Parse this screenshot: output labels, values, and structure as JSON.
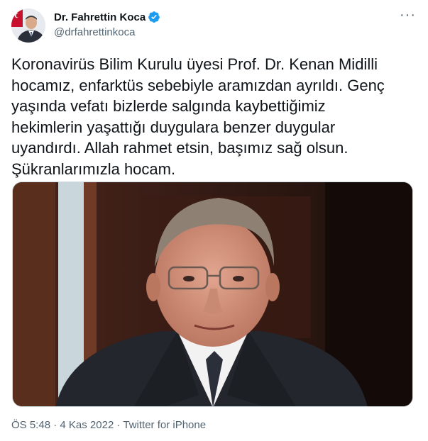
{
  "author": {
    "display_name": "Dr. Fahrettin Koca",
    "handle": "@drfahrettinkoca",
    "verified": true,
    "avatar_icon": "profile-photo"
  },
  "tweet": {
    "text": "Koronavirüs Bilim Kurulu üyesi Prof. Dr. Kenan Midilli\nhocamız, enfarktüs sebebiyle aramızdan ayrıldı. Genç\nyaşında vefatı bizlerde salgında kaybettiğimiz\nhekimlerin yaşattığı duygulara benzer duygular\nuyandırdı. Allah rahmet etsin, başımız sağ olsun.\nŞükranlarımızla hocam.",
    "media_icon": "photo-portrait"
  },
  "meta": {
    "time": "ÖS 5:48",
    "separator1": " · ",
    "date": "4 Kas 2022",
    "separator2": " · ",
    "source": "Twitter for iPhone"
  },
  "more_icon": "more-horizontal-icon",
  "colors": {
    "text": "#0f1419",
    "secondary": "#536471",
    "verified": "#1d9bf0"
  }
}
